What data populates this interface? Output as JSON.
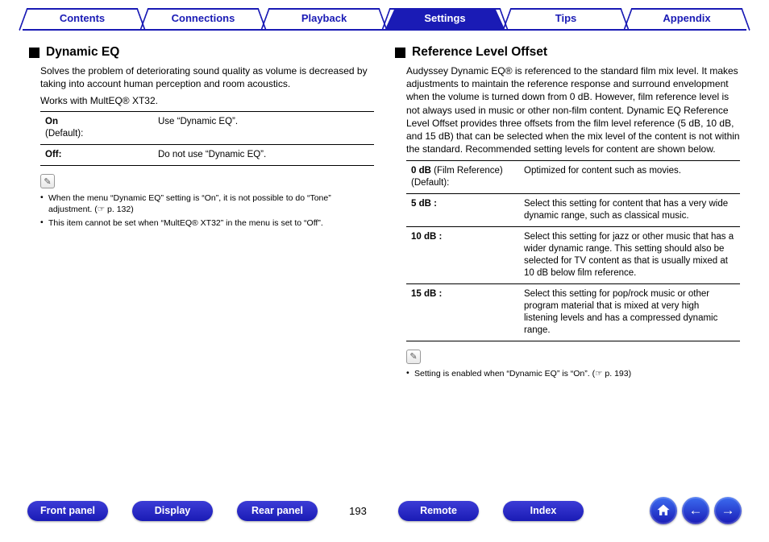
{
  "nav": {
    "tabs": [
      {
        "label": "Contents",
        "active": false
      },
      {
        "label": "Connections",
        "active": false
      },
      {
        "label": "Playback",
        "active": false
      },
      {
        "label": "Settings",
        "active": true
      },
      {
        "label": "Tips",
        "active": false
      },
      {
        "label": "Appendix",
        "active": false
      }
    ]
  },
  "page_number": "193",
  "left": {
    "heading": "Dynamic EQ",
    "intro": "Solves the problem of deteriorating sound quality as volume is decreased by taking into account human perception and room acoustics.",
    "works_with": "Works with MultEQ® XT32.",
    "options": [
      {
        "label": "On",
        "extra": "(Default):",
        "desc": "Use “Dynamic EQ”."
      },
      {
        "label": "Off:",
        "extra": "",
        "desc": "Do not use “Dynamic EQ”."
      }
    ],
    "notes": [
      "When the menu “Dynamic EQ” setting is “On”, it is not possible to do “Tone” adjustment.  (☞ p. 132)",
      "This item cannot be set when “MultEQ® XT32” in the menu is set to “Off”."
    ]
  },
  "right": {
    "heading": "Reference Level Offset",
    "intro": "Audyssey Dynamic EQ® is referenced to the standard film mix level. It makes adjustments to maintain the reference response and surround envelopment when the volume is turned down from 0 dB. However, film reference level is not always used in music or other non-film content. Dynamic EQ Reference Level Offset provides three offsets from the film level reference (5 dB, 10 dB, and 15 dB) that can be selected when the mix level of the content is not within the standard. Recommended setting levels for content are shown below.",
    "options": [
      {
        "label": "0 dB",
        "extra": "(Film Reference) (Default):",
        "desc": "Optimized for content such as movies."
      },
      {
        "label": "5 dB :",
        "extra": "",
        "desc": "Select this setting for content that has a very wide dynamic range, such as classical music."
      },
      {
        "label": "10 dB :",
        "extra": "",
        "desc": "Select this setting for jazz or other music that has a wider dynamic range. This setting should also be selected for TV content as that is usually mixed at 10 dB below film reference."
      },
      {
        "label": "15 dB :",
        "extra": "",
        "desc": "Select this setting for pop/rock music or other program material that is mixed at very high listening levels and has a compressed dynamic range."
      }
    ],
    "notes": [
      "Setting is enabled when “Dynamic EQ” is “On”.  (☞ p. 193)"
    ]
  },
  "bottom_links": {
    "front_panel": "Front panel",
    "display": "Display",
    "rear_panel": "Rear panel",
    "remote": "Remote",
    "index": "Index"
  },
  "icons": {
    "pencil": "✎",
    "home": "home-icon",
    "prev": "←",
    "next": "→"
  }
}
